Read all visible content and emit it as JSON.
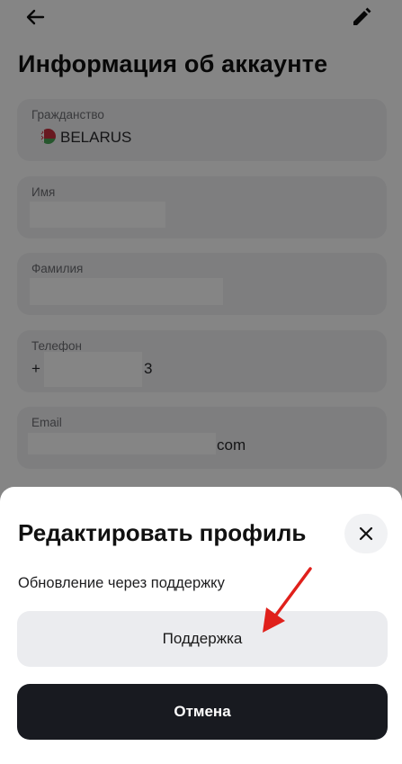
{
  "header": {
    "back_icon": "arrow-left-icon",
    "edit_icon": "pencil-icon",
    "title": "Информация об аккаунте"
  },
  "fields": {
    "citizenship": {
      "label": "Гражданство",
      "value": "BELARUS",
      "flag_icon": "belarus-flag-icon"
    },
    "first_name": {
      "label": "Имя"
    },
    "last_name": {
      "label": "Фамилия"
    },
    "phone": {
      "label": "Телефон",
      "prefix": "+",
      "suffix": "3"
    },
    "email": {
      "label": "Email",
      "suffix": "com"
    }
  },
  "sheet": {
    "title": "Редактировать профиль",
    "close_icon": "close-icon",
    "description": "Обновление через поддержку",
    "support_label": "Поддержка",
    "cancel_label": "Отмена"
  },
  "colors": {
    "card_bg": "#f1f2f4",
    "cancel_bg": "#181a20",
    "annotation_arrow": "#e0201b",
    "flag_red": "#c8313e",
    "flag_green": "#4aa657"
  }
}
